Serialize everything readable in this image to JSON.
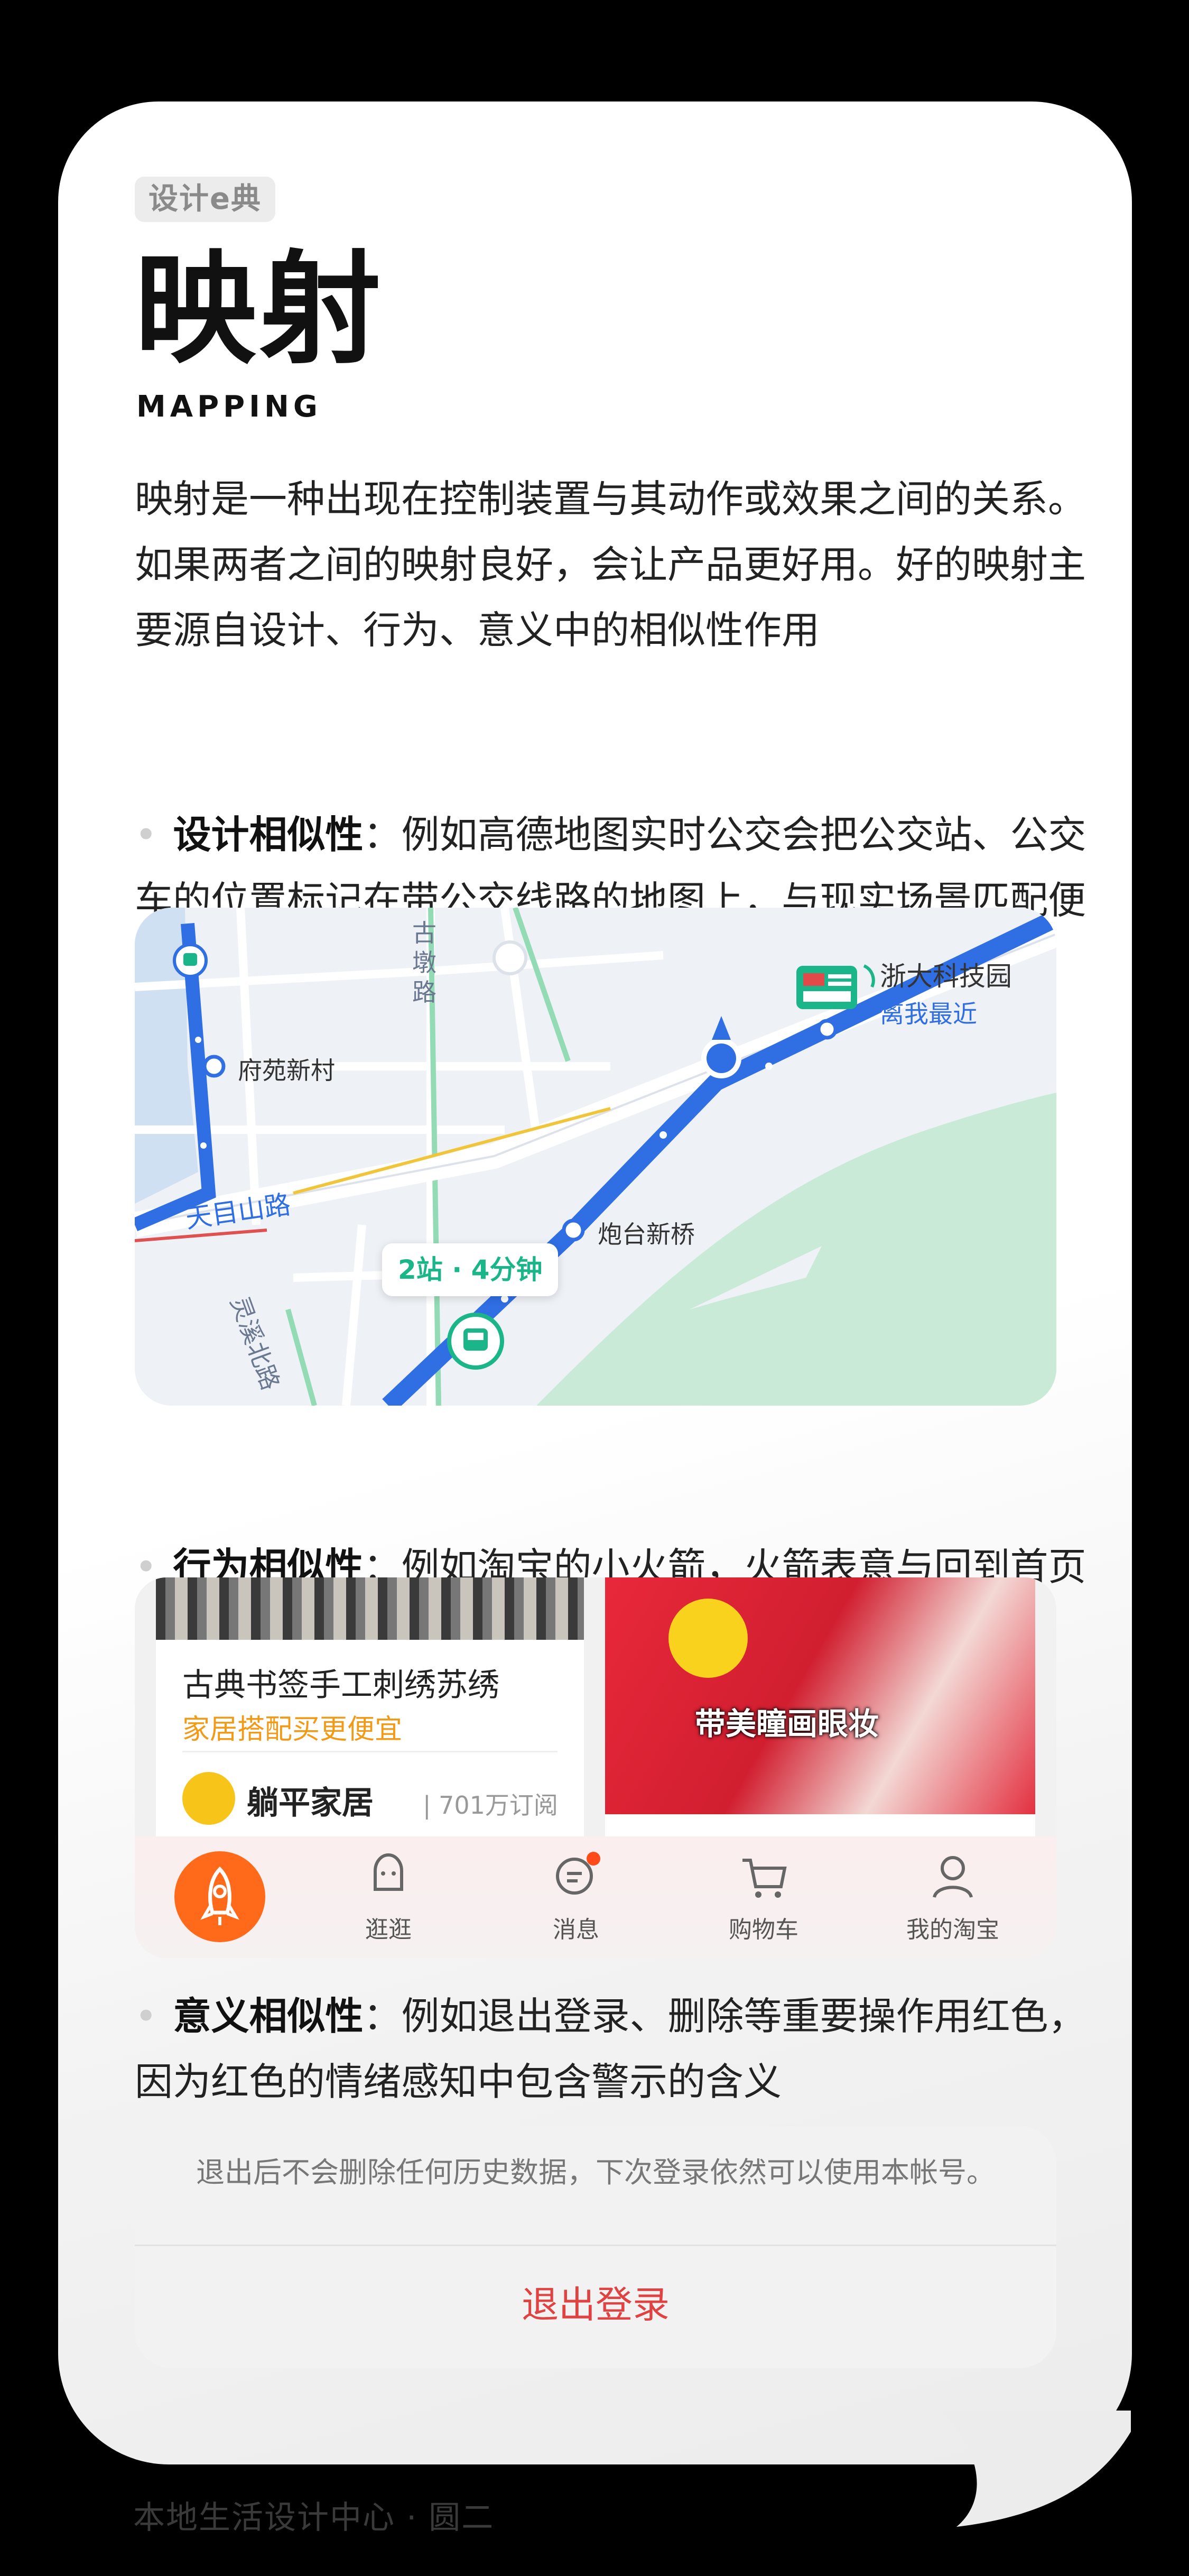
{
  "brand": "设计e典",
  "title": "映射",
  "subtitle": "MAPPING",
  "intro": "映射是一种出现在控制装置与其动作或效果之间的关系。如果两者之间的映射良好，会让产品更好用。好的映射主要源自设计、行为、意义中的相似性作用",
  "points": [
    {
      "bullet": "•",
      "head": "设计相似性",
      "body": "：例如高德地图实时公交会把公交站、公交车的位置标记在带公交线路的地图上，与现实场景匹配便于用户理解"
    },
    {
      "bullet": "•",
      "head": "行为相似性",
      "body": "：例如淘宝的小火箭，火箭表意与回到首页滚动方向一致"
    },
    {
      "bullet": "•",
      "head": "意义相似性",
      "body": "：例如退出登录、删除等重要操作用红色，因为红色的情绪感知中包含警示的含义"
    }
  ],
  "map": {
    "streets": [
      "古墩路",
      "天目山路",
      "灵溪北路"
    ],
    "stops": [
      "府苑新村",
      "炮台新桥"
    ],
    "destination": "浙大科技园",
    "destination_note": "离我最近",
    "eta": "2站 · 4分钟",
    "route_color": "#2f6ee3",
    "icons": [
      "bus-stop-icon",
      "bus-icon",
      "station-sign-icon",
      "location-arrow-icon"
    ]
  },
  "shop": {
    "product1_title": "古典书签手工刺绣苏绣",
    "product1_tag": "家居搭配买更便宜",
    "shop_name": "躺平家居",
    "subscribers": "| 701万订阅",
    "product2_caption": "带美瞳画眼妆",
    "tabs": [
      "逛逛",
      "消息",
      "购物车",
      "我的淘宝"
    ],
    "rocket_color": "#ff6a1a"
  },
  "logout": {
    "note": "退出后不会删除任何历史数据，下次登录依然可以使用本帐号。",
    "button": "退出登录"
  },
  "footer": "本地生活设计中心 · 圆二"
}
